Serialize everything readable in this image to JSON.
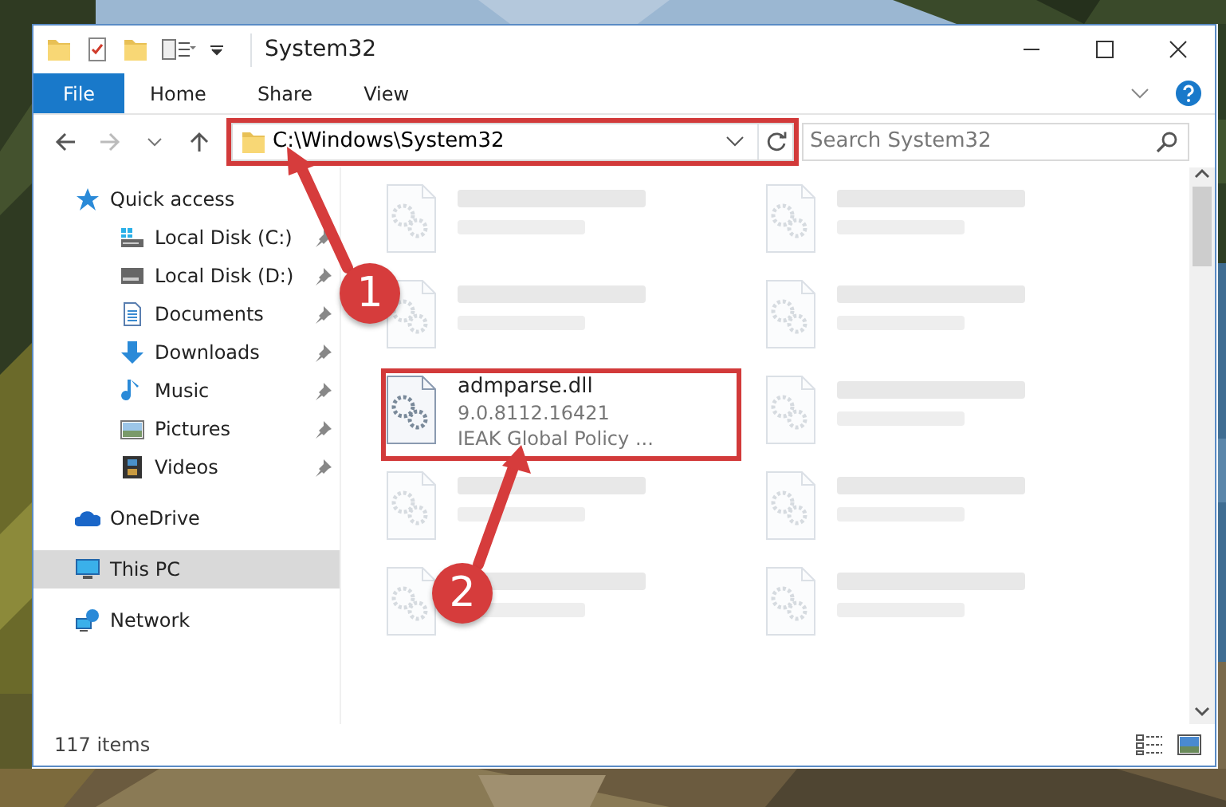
{
  "window": {
    "title": "System32"
  },
  "ribbon_tabs": [
    {
      "label": "File",
      "kind": "file",
      "selected": false
    },
    {
      "label": "Home",
      "kind": "tab",
      "selected": false
    },
    {
      "label": "Share",
      "kind": "tab",
      "selected": false
    },
    {
      "label": "View",
      "kind": "tab",
      "selected": false
    }
  ],
  "address_bar": {
    "path": "C:\\Windows\\System32",
    "highlighted": true
  },
  "search": {
    "placeholder": "Search System32"
  },
  "navigation": [
    {
      "label": "Quick access",
      "kind": "star",
      "selected": false,
      "children": [
        {
          "label": "Local Disk (C:)",
          "kind": "drive-c",
          "pinned": true,
          "selected": false
        },
        {
          "label": "Local Disk (D:)",
          "kind": "drive",
          "pinned": true,
          "selected": false
        },
        {
          "label": "Documents",
          "kind": "documents",
          "pinned": true,
          "selected": false
        },
        {
          "label": "Downloads",
          "kind": "downloads",
          "pinned": true,
          "selected": false
        },
        {
          "label": "Music",
          "kind": "music",
          "pinned": true,
          "selected": false
        },
        {
          "label": "Pictures",
          "kind": "pictures",
          "pinned": true,
          "selected": false
        },
        {
          "label": "Videos",
          "kind": "videos",
          "pinned": true,
          "selected": false
        }
      ]
    },
    {
      "label": "OneDrive",
      "kind": "cloud",
      "selected": false
    },
    {
      "label": "This PC",
      "kind": "pc",
      "selected": true
    },
    {
      "label": "Network",
      "kind": "network",
      "selected": false
    }
  ],
  "files": [
    {
      "kind": "blurred",
      "highlighted": false
    },
    {
      "kind": "blurred",
      "highlighted": false
    },
    {
      "kind": "blurred",
      "highlighted": false
    },
    {
      "kind": "blurred",
      "highlighted": false
    },
    {
      "kind": "file",
      "name": "admparse.dll",
      "details": [
        "9.0.8112.16421",
        "IEAK Global Policy ..."
      ],
      "highlighted": true
    },
    {
      "kind": "blurred",
      "highlighted": false
    },
    {
      "kind": "blurred",
      "highlighted": false
    },
    {
      "kind": "blurred",
      "highlighted": false
    },
    {
      "kind": "blurred",
      "highlighted": false
    },
    {
      "kind": "blurred",
      "highlighted": false
    }
  ],
  "status_bar": {
    "item_count": "117 items"
  },
  "callouts": [
    {
      "label": "1"
    },
    {
      "label": "2"
    }
  ]
}
